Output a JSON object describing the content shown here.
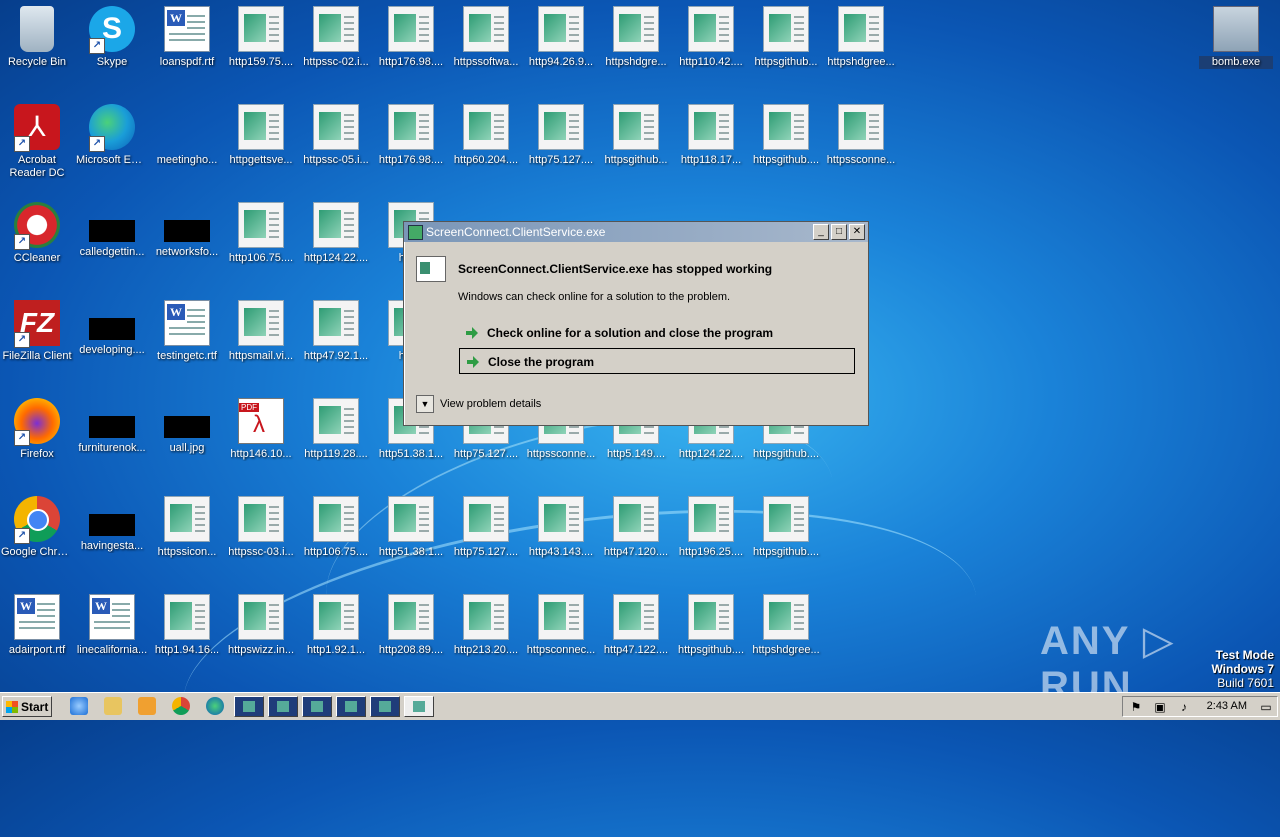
{
  "desktop": {
    "icons": [
      {
        "label": "Recycle Bin",
        "type": "bin"
      },
      {
        "label": "Skype",
        "type": "skype",
        "glyph": "S"
      },
      {
        "label": "loanspdf.rtf",
        "type": "doc",
        "glyph": "W"
      },
      {
        "label": "http159.75....",
        "type": "html"
      },
      {
        "label": "httpssc-02.i...",
        "type": "html"
      },
      {
        "label": "http176.98....",
        "type": "html"
      },
      {
        "label": "httpssoftwa...",
        "type": "html"
      },
      {
        "label": "http94.26.9...",
        "type": "html"
      },
      {
        "label": "httpshdgre...",
        "type": "html"
      },
      {
        "label": "http110.42....",
        "type": "html"
      },
      {
        "label": "httpsgithub...",
        "type": "html"
      },
      {
        "label": "httpshdgree...",
        "type": "html"
      },
      {
        "label": "bomb.exe",
        "type": "bomb"
      },
      {
        "label": "Acrobat Reader DC",
        "type": "acrobat",
        "glyph": "⅄"
      },
      {
        "label": "Microsoft Edge",
        "type": "edge"
      },
      {
        "label": "meetingho...",
        "type": "blank"
      },
      {
        "label": "httpgettsve...",
        "type": "html"
      },
      {
        "label": "httpssc-05.i...",
        "type": "html"
      },
      {
        "label": "http176.98....",
        "type": "html"
      },
      {
        "label": "http60.204....",
        "type": "html"
      },
      {
        "label": "http75.127....",
        "type": "html"
      },
      {
        "label": "httpsgithub...",
        "type": "html"
      },
      {
        "label": "http118.17...",
        "type": "html"
      },
      {
        "label": "httpsgithub....",
        "type": "html"
      },
      {
        "label": "httpssconne...",
        "type": "html"
      },
      {
        "label": "CCleaner",
        "type": "ccleaner"
      },
      {
        "label": "calledgettin...",
        "type": "black"
      },
      {
        "label": "networksfo...",
        "type": "black"
      },
      {
        "label": "http106.75....",
        "type": "html"
      },
      {
        "label": "http124.22....",
        "type": "html"
      },
      {
        "label": "http5",
        "type": "html"
      },
      {
        "label": "FileZilla Client",
        "type": "fz",
        "glyph": "FZ"
      },
      {
        "label": "developing....",
        "type": "black"
      },
      {
        "label": "testingetc.rtf",
        "type": "doc",
        "glyph": "W"
      },
      {
        "label": "httpsmail.vi...",
        "type": "html"
      },
      {
        "label": "http47.92.1...",
        "type": "html"
      },
      {
        "label": "http5",
        "type": "html"
      },
      {
        "label": "Firefox",
        "type": "firefox"
      },
      {
        "label": "furniturenok...",
        "type": "black"
      },
      {
        "label": "uall.jpg",
        "type": "black"
      },
      {
        "label": "http146.10...",
        "type": "pdf",
        "glyph": "PDF"
      },
      {
        "label": "http119.28....",
        "type": "html"
      },
      {
        "label": "http51.38.1...",
        "type": "html"
      },
      {
        "label": "http75.127....",
        "type": "html"
      },
      {
        "label": "httpssconne...",
        "type": "html"
      },
      {
        "label": "http5.149....",
        "type": "html"
      },
      {
        "label": "http124.22....",
        "type": "html"
      },
      {
        "label": "httpsgithub....",
        "type": "html"
      },
      {
        "label": "Google Chrome",
        "type": "chrome"
      },
      {
        "label": "havingesta...",
        "type": "black"
      },
      {
        "label": "httpssicon...",
        "type": "html"
      },
      {
        "label": "httpssc-03.i...",
        "type": "html"
      },
      {
        "label": "http106.75....",
        "type": "html"
      },
      {
        "label": "http51.38.1...",
        "type": "html"
      },
      {
        "label": "http75.127....",
        "type": "html"
      },
      {
        "label": "http43.143....",
        "type": "html"
      },
      {
        "label": "http47.120....",
        "type": "html"
      },
      {
        "label": "http196.25....",
        "type": "html"
      },
      {
        "label": "httpsgithub....",
        "type": "html"
      },
      {
        "label": "adairport.rtf",
        "type": "doc",
        "glyph": "W"
      },
      {
        "label": "linecalifornia...",
        "type": "doc",
        "glyph": "W"
      },
      {
        "label": "http1.94.16...",
        "type": "html"
      },
      {
        "label": "httpswizz.in...",
        "type": "html"
      },
      {
        "label": "http1.92.1...",
        "type": "html"
      },
      {
        "label": "http208.89....",
        "type": "html"
      },
      {
        "label": "http213.20....",
        "type": "html"
      },
      {
        "label": "httpsconnec...",
        "type": "html"
      },
      {
        "label": "http47.122....",
        "type": "html"
      },
      {
        "label": "httpsgithub....",
        "type": "html"
      },
      {
        "label": "httpshdgree...",
        "type": "html"
      }
    ]
  },
  "dialog": {
    "title": "ScreenConnect.ClientService.exe",
    "heading": "ScreenConnect.ClientService.exe has stopped working",
    "message": "Windows can check online for a solution to the problem.",
    "option1": "Check online for a solution and close the program",
    "option2": "Close the program",
    "details": "View problem details",
    "min_glyph": "_",
    "max_glyph": "□",
    "close_glyph": "✕",
    "expand_glyph": "▼"
  },
  "taskbar": {
    "start_label": "Start",
    "clock": "2:43 AM"
  },
  "watermark": {
    "brand": "ANY ▷ RUN",
    "mode": "Test Mode",
    "os": "Windows 7",
    "build": "Build 7601"
  },
  "colors": {
    "desktop_blue": "#1a82d8",
    "dialog_bg": "#d4d0c8",
    "arrow_green": "#2e9c44"
  }
}
